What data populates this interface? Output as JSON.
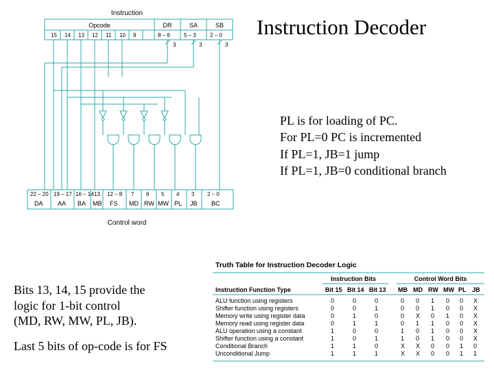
{
  "title": "Instruction Decoder",
  "side": {
    "l1": "PL is for loading of PC.",
    "l2": "For PL=0 PC is incremented",
    "l3": "If PL=1, JB=1 jump",
    "l4": "If PL=1, JB=0 conditional branch"
  },
  "bottomLeft": {
    "p1a": "Bits 13, 14, 15 provide the",
    "p1b": "logic for 1-bit control",
    "p1c": "(MD, RW, MW, PL, JB).",
    "p2": "Last 5 bits of op-code is for FS"
  },
  "diagram": {
    "topLabel": "Instruction",
    "fields": {
      "opcode": "Opcode",
      "dr": "DR",
      "sa": "SA",
      "sb": "SB"
    },
    "topBits": [
      "15",
      "14",
      "13",
      "12",
      "11",
      "10",
      "9",
      "8 – 6",
      "5 – 3",
      "2 – 0"
    ],
    "topWidths": {
      "a": "3",
      "b": "3",
      "c": "3"
    },
    "bottomBits": [
      "22 – 20",
      "19 – 17",
      "16 – 14",
      "13",
      "12 – 8",
      "7",
      "6",
      "5",
      "4",
      "3",
      "2 – 0"
    ],
    "bottomFields": [
      "DA",
      "AA",
      "BA",
      "MB",
      "FS",
      "MD",
      "RW",
      "MW",
      "PL",
      "JB",
      "BC"
    ],
    "bottomLabel": "Control word"
  },
  "truth": {
    "caption": "Truth Table for Instruction Decoder Logic",
    "groupHeaders": {
      "ib": "Instruction Bits",
      "cw": "Control Word Bits"
    },
    "cols": [
      "Instruction Function Type",
      "Bit 15",
      "Bit 14",
      "Bit 13",
      "MB",
      "MD",
      "RW",
      "MW",
      "PL",
      "JB"
    ],
    "rows": [
      [
        "ALU function using registers",
        "0",
        "0",
        "0",
        "0",
        "0",
        "1",
        "0",
        "0",
        "X"
      ],
      [
        "Shifter function using registers",
        "0",
        "0",
        "1",
        "0",
        "0",
        "1",
        "0",
        "0",
        "X"
      ],
      [
        "Memory write using register data",
        "0",
        "1",
        "0",
        "0",
        "X",
        "0",
        "1",
        "0",
        "X"
      ],
      [
        "Memory read using register data",
        "0",
        "1",
        "1",
        "0",
        "1",
        "1",
        "0",
        "0",
        "X"
      ],
      [
        "ALU operation using a constant",
        "1",
        "0",
        "0",
        "1",
        "0",
        "1",
        "0",
        "0",
        "X"
      ],
      [
        "Shifter function using a constant",
        "1",
        "0",
        "1",
        "1",
        "0",
        "1",
        "0",
        "0",
        "X"
      ],
      [
        "Conditional Branch",
        "1",
        "1",
        "0",
        "X",
        "X",
        "0",
        "0",
        "1",
        "0"
      ],
      [
        "Unconditional Jump",
        "1",
        "1",
        "1",
        "X",
        "X",
        "0",
        "0",
        "1",
        "1"
      ]
    ]
  }
}
